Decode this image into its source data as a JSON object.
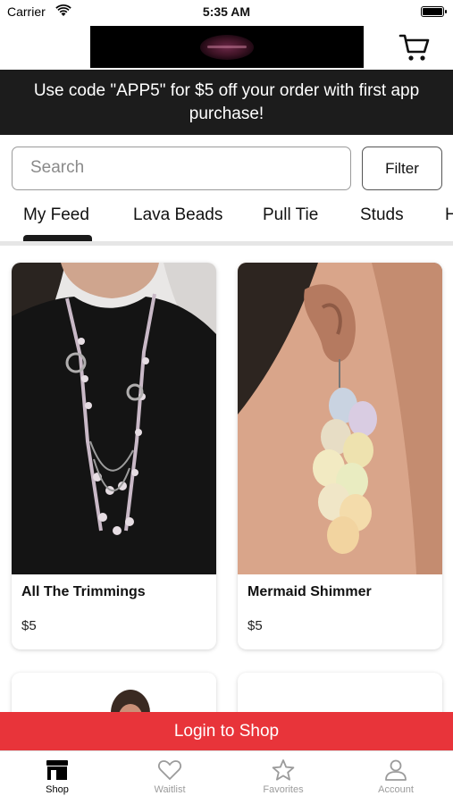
{
  "status_bar": {
    "carrier": "Carrier",
    "time": "5:35 AM"
  },
  "header": {
    "logo_alt": "store-logo",
    "cart_icon": "cart-icon"
  },
  "promo": {
    "text": "Use code \"APP5\" for $5 off your order with first app purchase!"
  },
  "search": {
    "placeholder": "Search",
    "filter_label": "Filter"
  },
  "tabs": [
    {
      "label": "My Feed",
      "selected": true
    },
    {
      "label": "Lava Beads"
    },
    {
      "label": "Pull Tie"
    },
    {
      "label": "Studs"
    },
    {
      "label": "H"
    }
  ],
  "products": [
    {
      "name": "All The Trimmings",
      "price": "$5"
    },
    {
      "name": "Mermaid Shimmer",
      "price": "$5"
    }
  ],
  "login_banner": {
    "label": "Login to Shop"
  },
  "tabbar": [
    {
      "label": "Shop",
      "icon": "shop-icon",
      "active": true
    },
    {
      "label": "Waitlist",
      "icon": "heart-icon"
    },
    {
      "label": "Favorites",
      "icon": "star-icon"
    },
    {
      "label": "Account",
      "icon": "person-icon"
    }
  ],
  "colors": {
    "promo_bg": "#1c1c1c",
    "login_bg": "#e8343a",
    "active_tab": "#000000",
    "inactive_tab": "#9b9b9b"
  }
}
